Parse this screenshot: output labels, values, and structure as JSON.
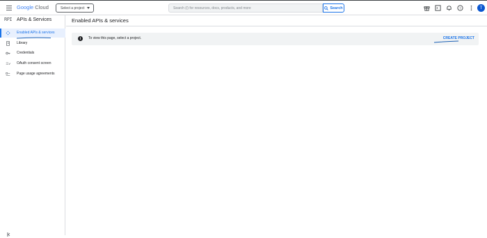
{
  "header": {
    "logo_google": "Google",
    "logo_cloud": "Cloud",
    "project_selector_label": "Select a project",
    "search_placeholder": "Search (/) for resources, docs, products, and more",
    "search_button_label": "Search",
    "avatar_initial": "T"
  },
  "sidebar": {
    "title_glyph": "RPI",
    "title": "APIs & Services",
    "items": [
      {
        "label": "Enabled APIs & services",
        "icon": "api-diamond-icon",
        "active": true
      },
      {
        "label": "Library",
        "icon": "library-icon",
        "active": false
      },
      {
        "label": "Credentials",
        "icon": "key-icon",
        "active": false
      },
      {
        "label": "OAuth consent screen",
        "icon": "consent-icon",
        "active": false
      },
      {
        "label": "Page usage agreements",
        "icon": "settings-list-icon",
        "active": false
      }
    ]
  },
  "main": {
    "page_title": "Enabled APIs & services",
    "banner": {
      "info_glyph": "i",
      "message": "To view this page, select a project.",
      "action_label": "CREATE PROJECT"
    }
  },
  "colors": {
    "accent": "#1a73e8",
    "active_bg": "#e8f0fe",
    "banner_bg": "#f1f3f4",
    "avatar_bg": "#0b57d0"
  }
}
